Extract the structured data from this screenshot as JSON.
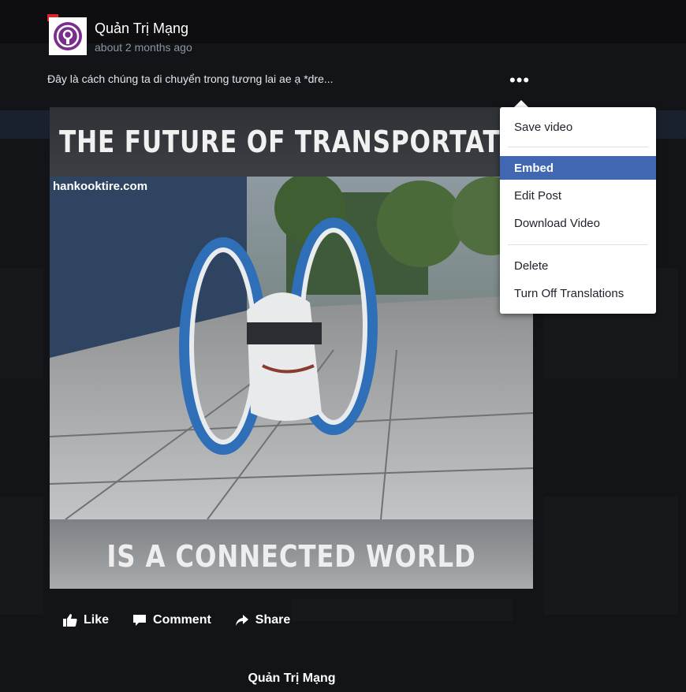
{
  "post": {
    "author": "Quản Trị Mạng",
    "time": "about 2 months ago",
    "caption": "Đây là cách chúng ta di chuyển trong tương lai ae ạ *dre...",
    "more_label": "•••"
  },
  "video": {
    "title": "THE FUTURE OF TRANSPORTATIO",
    "site": "hankooktire.com",
    "bottom_text": "IS A CONNECTED WORLD"
  },
  "actions": {
    "like": "Like",
    "comment": "Comment",
    "share": "Share"
  },
  "footer": {
    "name": "Quản Trị Mạng"
  },
  "menu": {
    "items": [
      {
        "label": "Save video"
      },
      {
        "label": "Embed"
      },
      {
        "label": "Edit Post"
      },
      {
        "label": "Download Video"
      },
      {
        "label": "Delete"
      },
      {
        "label": "Turn Off Translations"
      }
    ],
    "active_color": "#4267b2"
  },
  "icons": [
    "like-icon",
    "comment-icon",
    "share-icon",
    "more-icon",
    "avatar-logo-icon"
  ]
}
